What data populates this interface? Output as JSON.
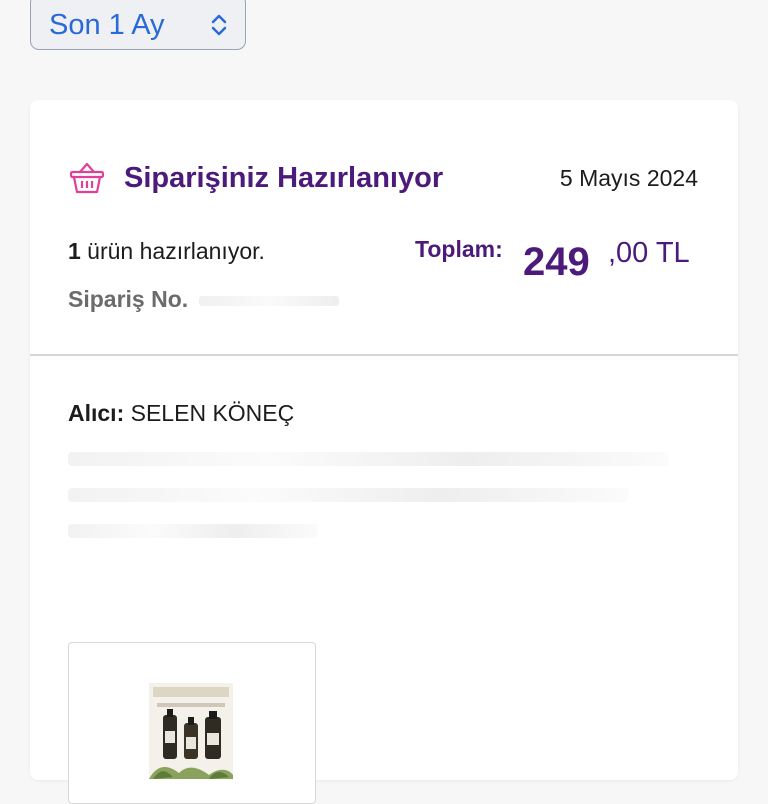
{
  "filter": {
    "label": "Son 1 Ay",
    "icon": "chevron-updown-icon"
  },
  "order": {
    "status": "Siparişiniz Hazırlanıyor",
    "status_icon": "basket-icon",
    "date": "5 Mayıs 2024",
    "count": "1",
    "count_text": " ürün hazırlanıyor.",
    "order_no_label": "Sipariş No.",
    "total_label": "Toplam:",
    "total_int": "249",
    "total_dec": ",00 TL",
    "recipient_label": "Alıcı:",
    "recipient_name": " SELEN KÖNEÇ"
  },
  "colors": {
    "brand": "#4b1a7a",
    "link": "#2a6ad8",
    "basket": "#e0409a"
  }
}
